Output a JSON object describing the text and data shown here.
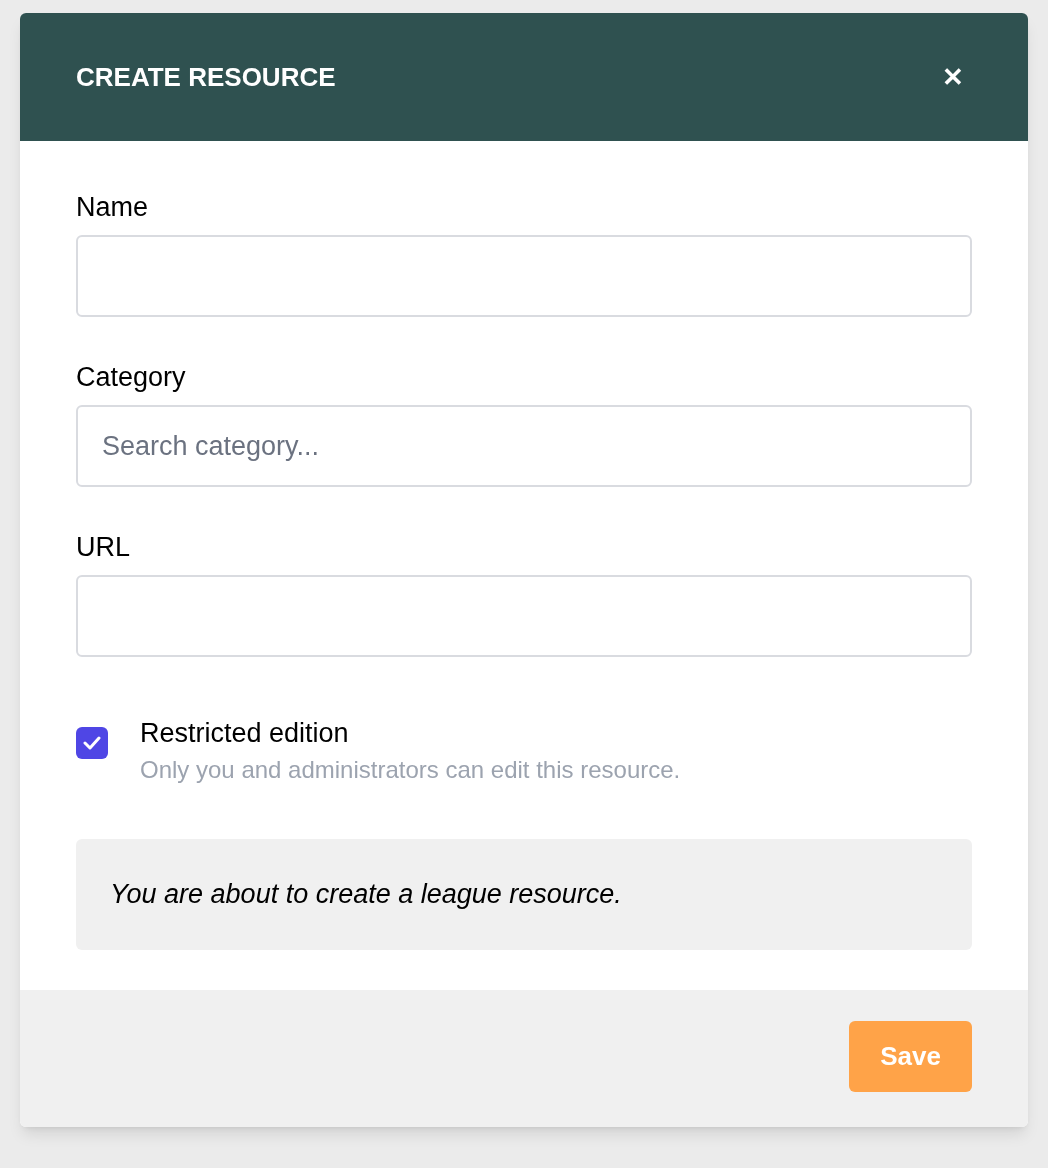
{
  "dialog": {
    "title": "CREATE RESOURCE",
    "close": "✕"
  },
  "fields": [
    {
      "label": "Name"
    },
    {
      "label": "Category",
      "placeholder": "Search category..."
    },
    {
      "label": "URL"
    }
  ],
  "restricted": {
    "title": "Restricted edition",
    "description": "Only you and administrators can edit this resource.",
    "checked": true
  },
  "notice": "You are about to create a league resource.",
  "buttons": [
    {
      "label": "Save"
    }
  ]
}
